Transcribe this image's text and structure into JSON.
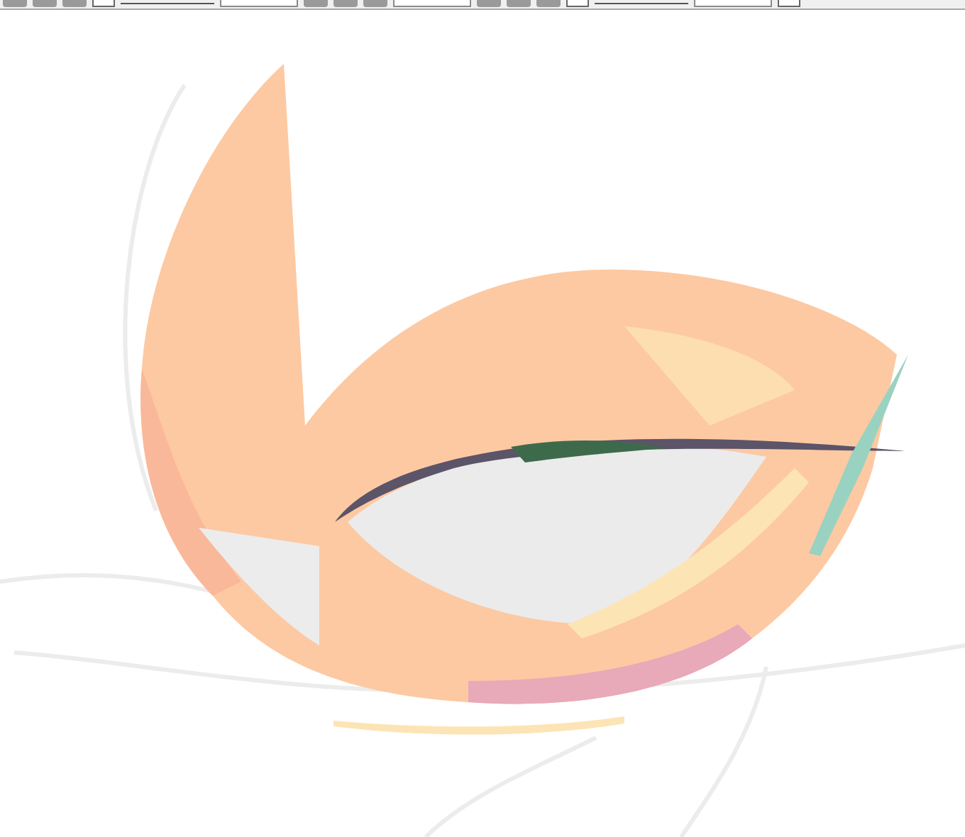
{
  "toolbar": {
    "controls": [
      {
        "kind": "button"
      },
      {
        "kind": "button"
      },
      {
        "kind": "button"
      },
      {
        "kind": "icon"
      },
      {
        "kind": "label"
      },
      {
        "kind": "dropdown"
      },
      {
        "kind": "button"
      },
      {
        "kind": "button"
      },
      {
        "kind": "button"
      },
      {
        "kind": "dropdown"
      },
      {
        "kind": "button"
      },
      {
        "kind": "button"
      },
      {
        "kind": "button"
      },
      {
        "kind": "icon"
      },
      {
        "kind": "label"
      },
      {
        "kind": "dropdown"
      },
      {
        "kind": "icon"
      }
    ]
  }
}
